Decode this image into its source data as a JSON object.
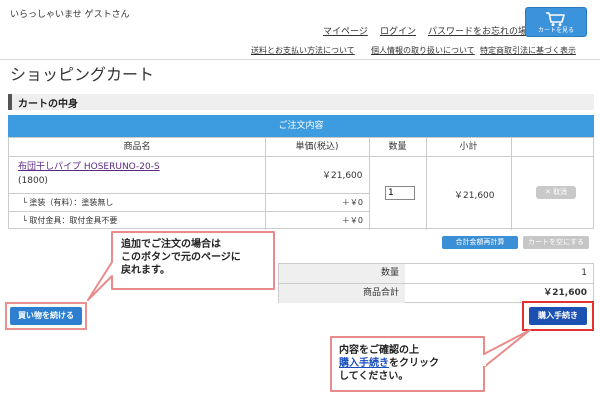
{
  "header": {
    "greeting": "いらっしゃいませ ゲストさん",
    "nav_primary": [
      "マイページ",
      "ログイン",
      "パスワードをお忘れの場合"
    ],
    "nav_secondary": [
      "送料とお支払い方法について",
      "個人情報の取り扱いについて",
      "特定商取引法に基づく表示"
    ],
    "cart_button_label": "カートを見る",
    "cart_icon": "shopping-cart-icon"
  },
  "page": {
    "title": "ショッピングカート",
    "section_title": "カートの中身"
  },
  "order_table": {
    "header_title": "ご注文内容",
    "columns": [
      "商品名",
      "単価(税込)",
      "数量",
      "小計"
    ],
    "item": {
      "name": "布団干しパイプ HOSERUNO-20-S",
      "code": "(1800)",
      "unit_price": "￥21,600",
      "quantity": "1",
      "subtotal": "￥21,600",
      "cancel_label": "✕ 取消",
      "options": [
        {
          "label": "塗装（有料）：塗装無し",
          "price": "＋￥0"
        },
        {
          "label": "取付金具：取付金具不要",
          "price": "＋￥0"
        }
      ]
    }
  },
  "actions": {
    "recalc_label": "合計金額再計算",
    "empty_label": "カートを空にする",
    "continue_label": "買い物を続ける",
    "checkout_label": "購入手続き"
  },
  "summary": {
    "quantity_label": "数量",
    "quantity_value": "1",
    "total_label": "商品合計",
    "total_value": "￥21,600"
  },
  "callouts": {
    "continue_note": [
      "追加でご注文の場合は",
      "このボタンで元のページに",
      "戻れます。"
    ],
    "checkout_note_line1": "内容をご確認の上",
    "checkout_note_em": "購入手続き",
    "checkout_note_rest": "をクリック",
    "checkout_note_line3": "してください。"
  },
  "colors": {
    "accent_blue": "#3d9be0",
    "checkout_blue": "#1c51b2",
    "callout_border": "#e63030"
  }
}
